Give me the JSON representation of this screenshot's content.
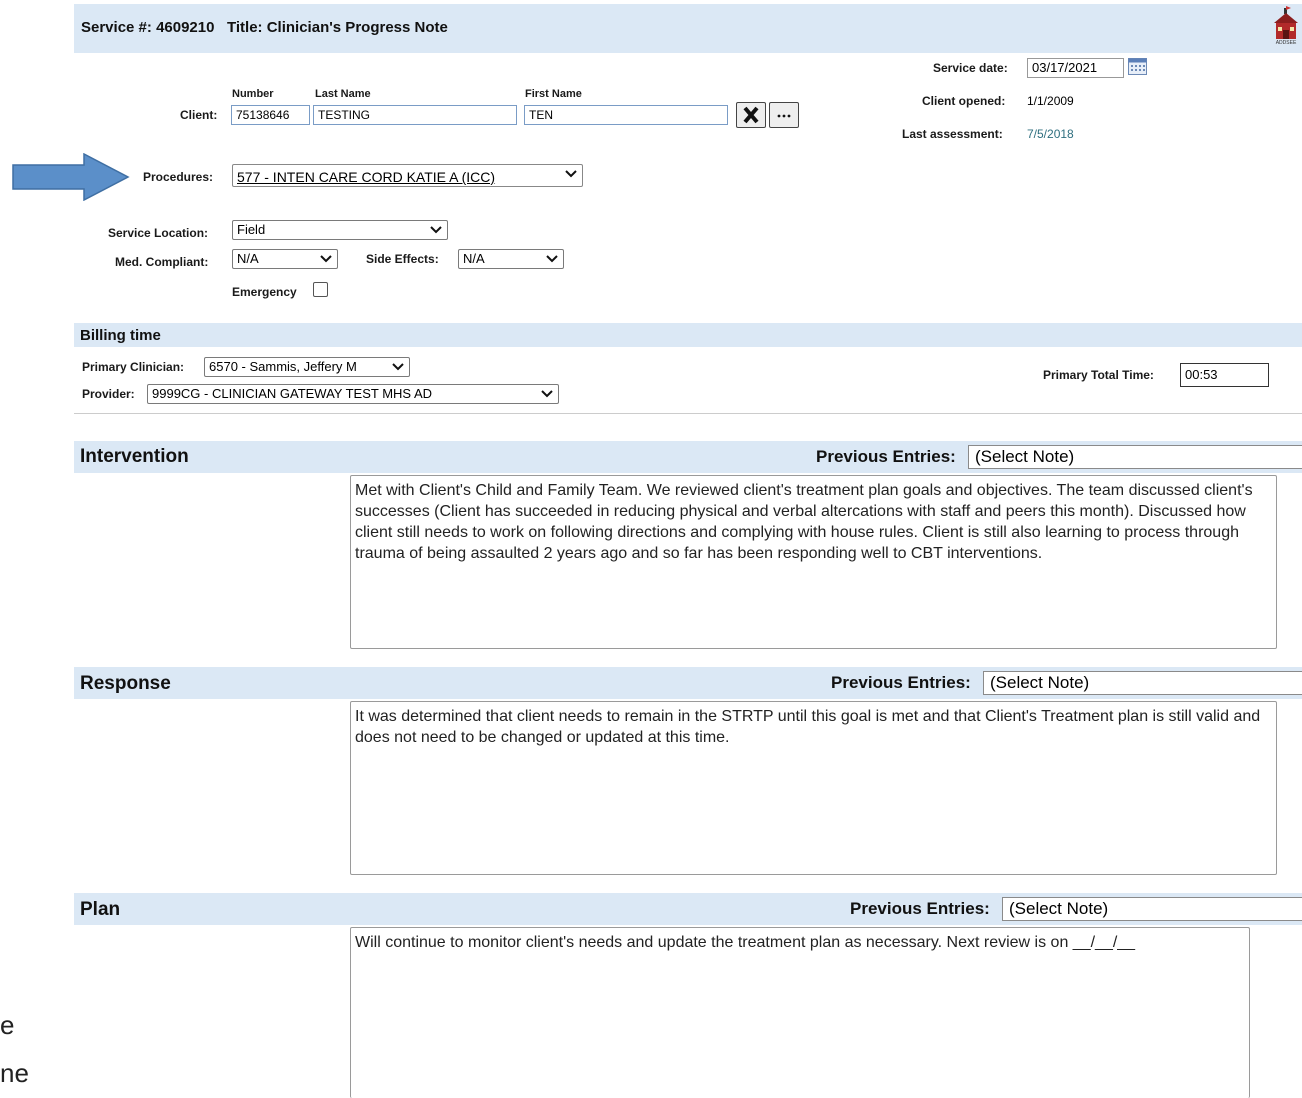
{
  "header": {
    "service_label": "Service #:",
    "service_number": "4609210",
    "title_label": "Title:",
    "title": "Clinician's Progress Note",
    "logo_text": "ADDSEE"
  },
  "client": {
    "col_number": "Number",
    "col_last": "Last Name",
    "col_first": "First Name",
    "label": "Client:",
    "number": "75138646",
    "last_name": "TESTING",
    "first_name": "TEN"
  },
  "right_info": {
    "service_date_label": "Service date:",
    "service_date": "03/17/2021",
    "client_opened_label": "Client opened:",
    "client_opened": "1/1/2009",
    "last_assessment_label": "Last assessment:",
    "last_assessment": "7/5/2018"
  },
  "procedures": {
    "label": "Procedures:",
    "value": "577 - INTEN CARE CORD KATIE A (ICC)"
  },
  "service_location": {
    "label": "Service Location:",
    "value": "Field"
  },
  "med_compliant": {
    "label": "Med. Compliant:",
    "value": "N/A"
  },
  "side_effects": {
    "label": "Side Effects:",
    "value": "N/A"
  },
  "emergency": {
    "label": "Emergency",
    "checked": false
  },
  "billing": {
    "title": "Billing time",
    "primary_clinician_label": "Primary Clinician:",
    "primary_clinician": "6570 - Sammis, Jeffery M",
    "provider_label": "Provider:",
    "provider": "9999CG - CLINICIAN GATEWAY TEST MHS AD",
    "total_time_label": "Primary Total Time:",
    "total_time": "00:53"
  },
  "sections": {
    "intervention": {
      "title": "Intervention",
      "prev_label": "Previous Entries:",
      "prev_value": "(Select Note)",
      "text": "Met with Client's Child and Family Team. We reviewed client's treatment plan goals and objectives. The team discussed client's successes (Client has succeeded in reducing physical and verbal altercations with staff and peers this month). Discussed how client still needs to work on following directions and complying with house rules. Client is still also learning to process through trauma of being assaulted 2 years ago and so far has been responding well to CBT interventions."
    },
    "response": {
      "title": "Response",
      "prev_label": "Previous Entries:",
      "prev_value": "(Select Note)",
      "text": "It was determined that client needs to remain in the STRTP until this goal is met and that Client's Treatment plan is still valid and does not need to be changed or updated at this time."
    },
    "plan": {
      "title": "Plan",
      "prev_label": "Previous Entries:",
      "prev_value": "(Select Note)",
      "text": "Will continue to monitor client's needs and update the treatment plan as necessary. Next review is on __/__/__"
    }
  },
  "left_edge_fragment": {
    "line1": "e",
    "line2": "ne"
  },
  "colors": {
    "band": "#dbe8f5",
    "arrow": "#5b8fc9",
    "date_blue": "#2f6f7f"
  }
}
